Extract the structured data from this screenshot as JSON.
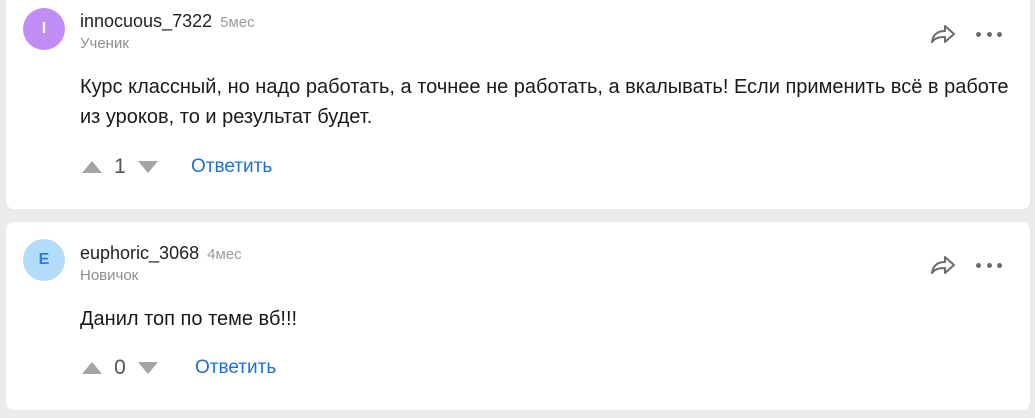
{
  "comments": [
    {
      "avatar_letter": "I",
      "avatar_color": "#c18cf5",
      "author": "innocuous_7322",
      "time": "5мес",
      "role": "Ученик",
      "text": "Курс классный, но надо работать, а точнее не работать, а вкалывать! Если применить всё в работе из уроков, то и результат будет.",
      "votes": "1",
      "reply_label": "Ответить",
      "icons": {
        "share": "share-arrow-icon",
        "more": "more-dots-icon",
        "up": "upvote-icon",
        "down": "downvote-icon"
      }
    },
    {
      "avatar_letter": "E",
      "avatar_color": "#b3dcfb",
      "author": "euphoric_3068",
      "time": "4мес",
      "role": "Новичок",
      "text": "Данил топ по теме вб!!!",
      "votes": "0",
      "reply_label": "Ответить",
      "icons": {
        "share": "share-arrow-icon",
        "more": "more-dots-icon",
        "up": "upvote-icon",
        "down": "downvote-icon"
      }
    }
  ]
}
